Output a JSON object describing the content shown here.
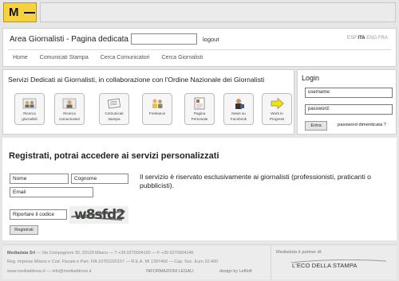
{
  "topbar": {
    "logo_letter": "M"
  },
  "header": {
    "title": "Area Giornalisti - Pagina dedicata a:",
    "logout": "logout",
    "languages": {
      "esp": "ESP",
      "ita": "ITA",
      "eng": "ENG",
      "fra": "FRA"
    }
  },
  "nav": {
    "home": "Home",
    "comunicati_stampa": "Comunicati Stampa",
    "cerca_comunicatori": "Cerca Comunicatori",
    "cerca_giornalisti": "Cerca Giornalisti"
  },
  "services": {
    "title": "Servizi Dedicati ai Giornalisti, in collaborazione con l'Ordine Nazionale dei Giornalisti",
    "items": [
      {
        "label1": "Ricerca",
        "label2": "giornalisti",
        "icon": "people-search-icon"
      },
      {
        "label1": "Ricerca",
        "label2": "comunicatori",
        "icon": "people-search-icon"
      },
      {
        "label1": "Comunicati",
        "label2": "stampa",
        "icon": "press-release-icon"
      },
      {
        "label1": "Freelance",
        "label2": "",
        "icon": "freelance-people-icon"
      },
      {
        "label1": "Pagina",
        "label2": "Personale",
        "icon": "personal-page-icon"
      },
      {
        "label1": "News su",
        "label2": "Facebook",
        "icon": "facebook-news-icon"
      },
      {
        "label1": "Work in",
        "label2": "Progress",
        "icon": "arrow-right-icon"
      }
    ]
  },
  "login": {
    "title": "Login",
    "username": "username:",
    "password": "password:",
    "submit": "Entra",
    "forgot": "password dimenticata ?"
  },
  "register": {
    "title": "Registrati, potrai accedere ai servizi personalizzati",
    "nome": "Nome",
    "cognome": "Cognome",
    "email": "Email",
    "captcha_prompt": "Riportare il codice",
    "captcha_code": "w8sfd2",
    "submit": "Registrati",
    "info": "Il servizio è riservato esclusivamente ai giornalisti (professionisti, praticanti o pubblicisti)."
  },
  "footer": {
    "company": "Mediadata Srl",
    "line1": " — Via Compagnoni 30, 20129 Milano — T +39 0270004150 — F +39 0270004146",
    "line2": "Reg. Imprese Milano e Cod. Fiscale e Part. IVA 10701020157 — R.E.A. MI 1397450 — Cap. Soc. Euro 10.400",
    "line3": "www.mediaddress.it — info@mediaddress.it",
    "legal": "INFORMAZIONI LEGALI",
    "design": "design by Leftloft",
    "partner_text": "Mediadata è partner di:",
    "partner_logo": "L'ECO DELLA STAMPA"
  }
}
